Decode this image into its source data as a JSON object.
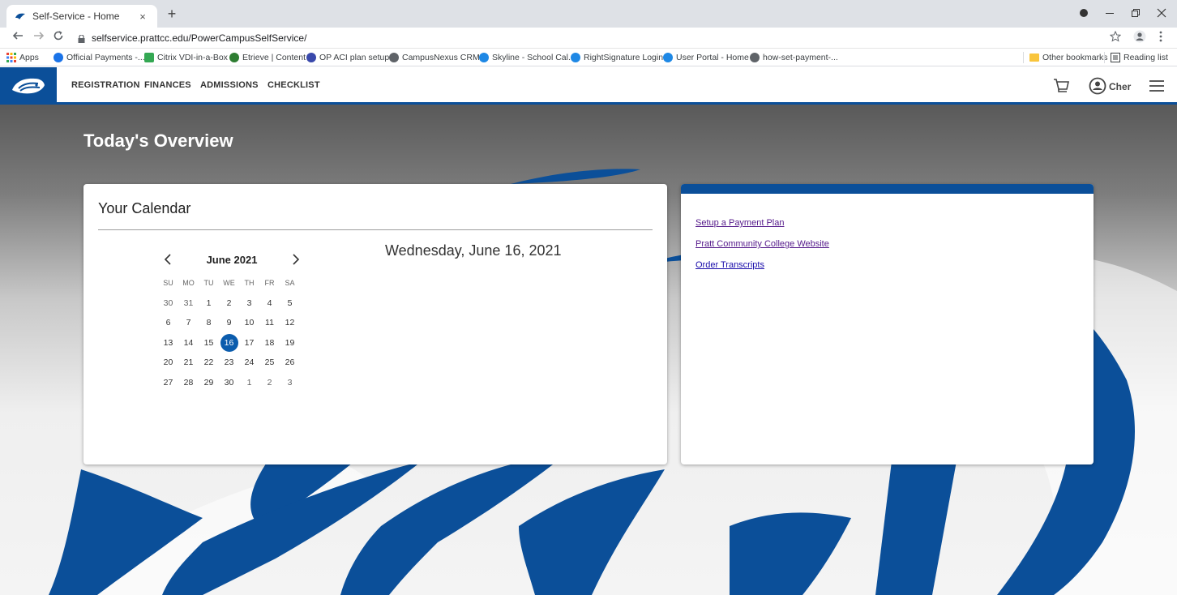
{
  "browser": {
    "tab_title": "Self-Service - Home",
    "tab_close": "×",
    "new_tab": "+",
    "url": "selfservice.prattcc.edu/PowerCampusSelfService/",
    "bookmarks": [
      {
        "label": "Apps",
        "color": "#ea4335"
      },
      {
        "label": "Official Payments -...",
        "color": "#1a73e8"
      },
      {
        "label": "Citrix VDI-in-a-Box",
        "color": "#34a853"
      },
      {
        "label": "Etrieve | Content",
        "color": "#2e7d32"
      },
      {
        "label": "OP ACI plan setup",
        "color": "#3949ab"
      },
      {
        "label": "CampusNexus CRM",
        "color": "#5f6368"
      },
      {
        "label": "Skyline - School Cal...",
        "color": "#1e88e5"
      },
      {
        "label": "RightSignature Login",
        "color": "#1e88e5"
      },
      {
        "label": "User Portal - Home",
        "color": "#1e88e5"
      },
      {
        "label": "how-set-payment-...",
        "color": "#5f6368"
      }
    ],
    "other_bookmarks": "Other bookmarks",
    "reading_list": "Reading list"
  },
  "header": {
    "nav": [
      "REGISTRATION",
      "FINANCES",
      "ADMISSIONS",
      "CHECKLIST"
    ],
    "user_name": "Cher",
    "brand_color": "#0b4f99"
  },
  "main": {
    "page_title": "Today's Overview",
    "calendar": {
      "title": "Your Calendar",
      "selected_date": "Wednesday, June 16, 2021",
      "month_label": "June 2021",
      "prev": "‹",
      "next": "›",
      "weekdays": [
        "SU",
        "MO",
        "TU",
        "WE",
        "TH",
        "FR",
        "SA"
      ],
      "weeks": [
        [
          "30",
          "31",
          "1",
          "2",
          "3",
          "4",
          "5"
        ],
        [
          "6",
          "7",
          "8",
          "9",
          "10",
          "11",
          "12"
        ],
        [
          "13",
          "14",
          "15",
          "16",
          "17",
          "18",
          "19"
        ],
        [
          "20",
          "21",
          "22",
          "23",
          "24",
          "25",
          "26"
        ],
        [
          "27",
          "28",
          "29",
          "30",
          "1",
          "2",
          "3"
        ]
      ],
      "today": "16"
    },
    "links": [
      "Setup a Payment Plan",
      "Pratt Community College Website",
      "Order Transcripts"
    ]
  }
}
